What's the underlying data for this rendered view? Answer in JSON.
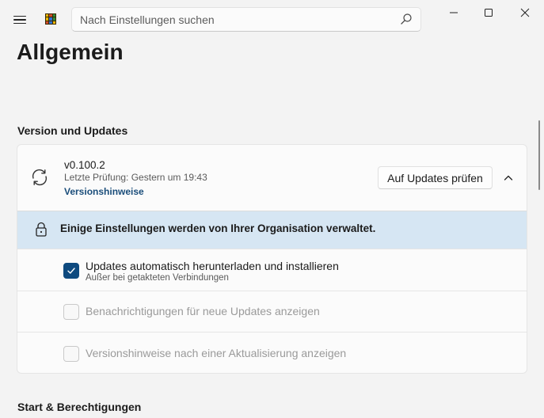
{
  "titlebar": {
    "search_placeholder": "Nach Einstellungen suchen",
    "menu_icon": "hamburger-menu-icon",
    "app_icon": "powertoys-app-icon",
    "search_icon": "search-icon",
    "window_buttons": [
      "minimize-icon",
      "maximize-icon",
      "close-icon"
    ]
  },
  "page": {
    "title": "Allgemein"
  },
  "sections": {
    "version_updates": "Version und Updates",
    "start_permissions": "Start & Berechtigungen"
  },
  "version_card": {
    "version": "v0.100.2",
    "last_check": "Letzte Prüfung:  Gestern um 19:43",
    "release_notes_link": "Versionshinweise",
    "check_updates_button": "Auf Updates prüfen",
    "policy_banner": "Einige Einstellungen werden von Ihrer Organisation verwaltet.",
    "options": [
      {
        "label": "Updates automatisch herunterladen und installieren",
        "sub": "Außer bei getakteten Verbindungen",
        "checked": true,
        "enabled": true
      },
      {
        "label": "Benachrichtigungen für neue Updates anzeigen",
        "checked": false,
        "enabled": false
      },
      {
        "label": "Versionshinweise nach einer Aktualisierung anzeigen",
        "checked": false,
        "enabled": false
      }
    ]
  },
  "colors": {
    "accent": "#0e4a7f",
    "link": "#1a4d7a",
    "banner_bg": "#d6e6f3",
    "background": "#f3f3f3"
  }
}
